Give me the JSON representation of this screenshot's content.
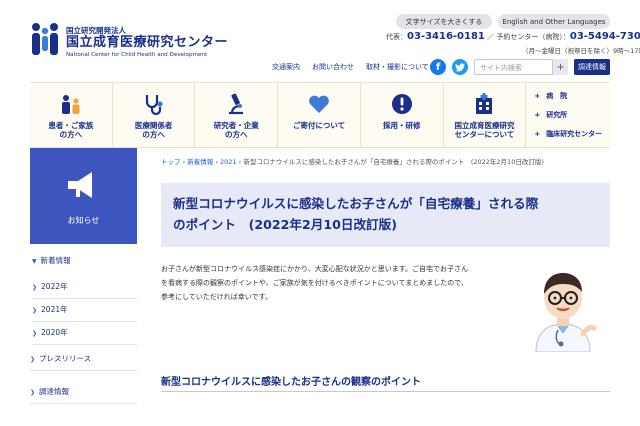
{
  "header": {
    "logo": {
      "sub": "国立研究開発法人",
      "main": "国立成育医療研究センター",
      "en": "National Center for Child Health and Development"
    },
    "font_size_button": "文字サイズを大きくする",
    "language_button": "English and Other Languages",
    "phone": {
      "rep_label": "代表：",
      "rep_number": "03-3416-0181",
      "sep": "／",
      "reserve_label": "予約センター（病院）：",
      "reserve_number": "03-5494-7300"
    },
    "hours": "（月〜金曜日（祝祭日を除く）9時〜17時）",
    "util_links": [
      "交通案内",
      "お問い合わせ",
      "取材・撮影について"
    ],
    "search_placeholder": "サイト内検索",
    "search_icon": "search-icon",
    "procurement_button": "調達情報"
  },
  "gnav": {
    "items": [
      {
        "label": "患者・ご家族\nの方へ",
        "icon": "family-icon"
      },
      {
        "label": "医療関係者\nの方へ",
        "icon": "stethoscope-icon"
      },
      {
        "label": "研究者・企業\nの方へ",
        "icon": "microscope-icon"
      },
      {
        "label": "ご寄付について",
        "icon": "heart-icon"
      },
      {
        "label": "採用・研修",
        "icon": "exclamation-icon"
      },
      {
        "label": "国立成育医療研究\nセンターについて",
        "icon": "hospital-building-icon"
      }
    ],
    "side": [
      "病　院",
      "研究所",
      "臨床研究センター"
    ]
  },
  "sidebar": {
    "news_label": "お知らせ",
    "news_icon": "megaphone-icon",
    "heading": "新着情報",
    "years": [
      "2022年",
      "2021年",
      "2020年"
    ],
    "press": "プレスリリース",
    "procurement": "調達情報"
  },
  "breadcrumb": {
    "top": "トップ",
    "news": "新着情報",
    "year": "2021",
    "sep": "›",
    "current": "新型コロナウイルスに感染したお子さんが「自宅療養」される際のポイント　(2022年2月10日改訂版)"
  },
  "article": {
    "title_line1": "新型コロナウイルスに感染したお子さんが「自宅療養」される際",
    "title_line2": "のポイント　(2022年2月10日改訂版)",
    "intro_line1": "お子さんが新型コロナウイルス感染症にかかり、大変心配な状況かと思います。ご自宅でお子さん",
    "intro_line2": "を看病する際の観察のポイントや、ご家族が気を付けるべきポイントについてまとめましたので、",
    "intro_line3": "参考にしていただければ幸いです。",
    "section_title": "新型コロナウイルスに感染したお子さんの観察のポイント"
  },
  "colors": {
    "brand": "#1a2f8a",
    "accent": "#3d55bf",
    "title_bg": "#e7eaf6",
    "nav_bg": "#fdfbf2"
  }
}
